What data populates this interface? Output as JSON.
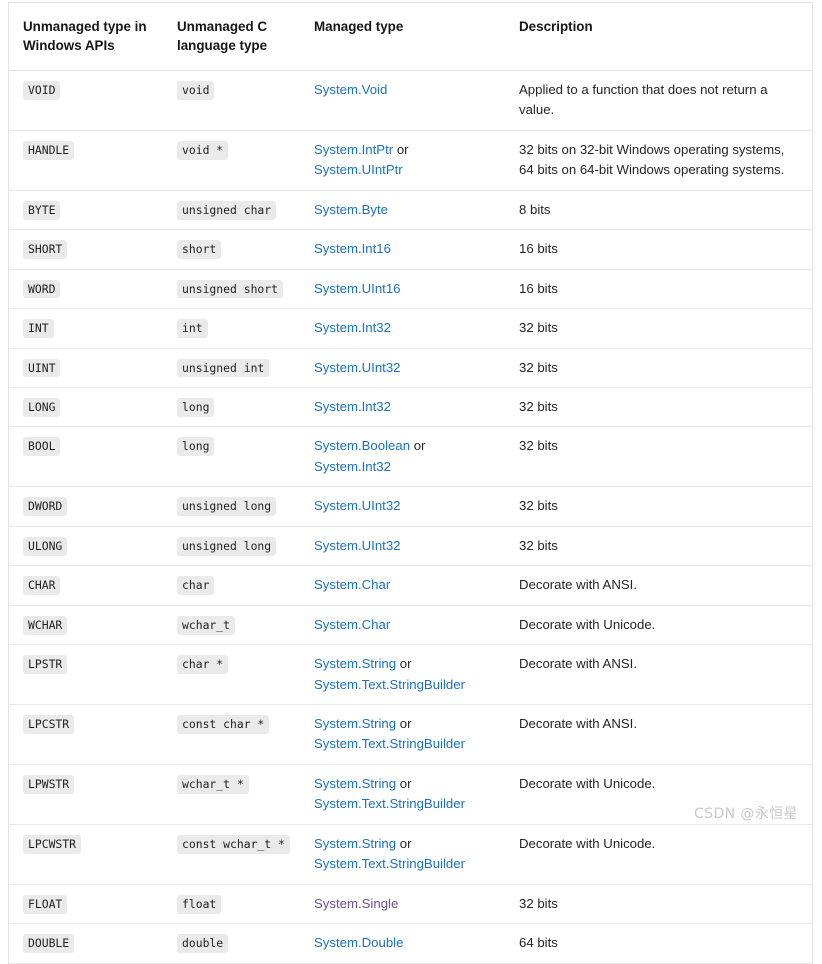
{
  "table": {
    "headers": [
      "Unmanaged type in Windows APIs",
      "Unmanaged C language type",
      "Managed type",
      "Description"
    ],
    "link_color": "#1a70c7",
    "visited_link_color": "#6b4e9e",
    "code_chip_bg": "#eaeaea",
    "border_color": "#e3e3e3",
    "or_separator": " or ",
    "rows": [
      {
        "unmanaged": "VOID",
        "ctype": "void",
        "managed": [
          {
            "text": "System.Void",
            "visited": false
          }
        ],
        "description": "Applied to a function that does not return a value."
      },
      {
        "unmanaged": "HANDLE",
        "ctype": "void *",
        "managed": [
          {
            "text": "System.IntPtr",
            "visited": false
          },
          {
            "text": "System.UIntPtr",
            "visited": false
          }
        ],
        "description": "32 bits on 32-bit Windows operating systems, 64 bits on 64-bit Windows operating systems."
      },
      {
        "unmanaged": "BYTE",
        "ctype": "unsigned char",
        "managed": [
          {
            "text": "System.Byte",
            "visited": false
          }
        ],
        "description": "8 bits"
      },
      {
        "unmanaged": "SHORT",
        "ctype": "short",
        "managed": [
          {
            "text": "System.Int16",
            "visited": false
          }
        ],
        "description": "16 bits"
      },
      {
        "unmanaged": "WORD",
        "ctype": "unsigned short",
        "managed": [
          {
            "text": "System.UInt16",
            "visited": false
          }
        ],
        "description": "16 bits"
      },
      {
        "unmanaged": "INT",
        "ctype": "int",
        "managed": [
          {
            "text": "System.Int32",
            "visited": false
          }
        ],
        "description": "32 bits"
      },
      {
        "unmanaged": "UINT",
        "ctype": "unsigned int",
        "managed": [
          {
            "text": "System.UInt32",
            "visited": false
          }
        ],
        "description": "32 bits"
      },
      {
        "unmanaged": "LONG",
        "ctype": "long",
        "managed": [
          {
            "text": "System.Int32",
            "visited": false
          }
        ],
        "description": "32 bits"
      },
      {
        "unmanaged": "BOOL",
        "ctype": "long",
        "managed": [
          {
            "text": "System.Boolean",
            "visited": false
          },
          {
            "text": "System.Int32",
            "visited": false
          }
        ],
        "description": "32 bits"
      },
      {
        "unmanaged": "DWORD",
        "ctype": "unsigned long",
        "managed": [
          {
            "text": "System.UInt32",
            "visited": false
          }
        ],
        "description": "32 bits"
      },
      {
        "unmanaged": "ULONG",
        "ctype": "unsigned long",
        "managed": [
          {
            "text": "System.UInt32",
            "visited": false
          }
        ],
        "description": "32 bits"
      },
      {
        "unmanaged": "CHAR",
        "ctype": "char",
        "managed": [
          {
            "text": "System.Char",
            "visited": false
          }
        ],
        "description": "Decorate with ANSI."
      },
      {
        "unmanaged": "WCHAR",
        "ctype": "wchar_t",
        "managed": [
          {
            "text": "System.Char",
            "visited": false
          }
        ],
        "description": "Decorate with Unicode."
      },
      {
        "unmanaged": "LPSTR",
        "ctype": "char *",
        "managed": [
          {
            "text": "System.String",
            "visited": false
          },
          {
            "text": "System.Text.StringBuilder",
            "visited": false
          }
        ],
        "description": "Decorate with ANSI."
      },
      {
        "unmanaged": "LPCSTR",
        "ctype": "const char *",
        "managed": [
          {
            "text": "System.String",
            "visited": false
          },
          {
            "text": "System.Text.StringBuilder",
            "visited": false
          }
        ],
        "description": "Decorate with ANSI."
      },
      {
        "unmanaged": "LPWSTR",
        "ctype": "wchar_t *",
        "managed": [
          {
            "text": "System.String",
            "visited": false
          },
          {
            "text": "System.Text.StringBuilder",
            "visited": false
          }
        ],
        "description": "Decorate with Unicode."
      },
      {
        "unmanaged": "LPCWSTR",
        "ctype": "const wchar_t *",
        "managed": [
          {
            "text": "System.String",
            "visited": false
          },
          {
            "text": "System.Text.StringBuilder",
            "visited": false
          }
        ],
        "description": "Decorate with Unicode."
      },
      {
        "unmanaged": "FLOAT",
        "ctype": "float",
        "managed": [
          {
            "text": "System.Single",
            "visited": true
          }
        ],
        "description": "32 bits"
      },
      {
        "unmanaged": "DOUBLE",
        "ctype": "double",
        "managed": [
          {
            "text": "System.Double",
            "visited": false
          }
        ],
        "description": "64 bits"
      }
    ]
  },
  "watermark": "CSDN @永恒星"
}
